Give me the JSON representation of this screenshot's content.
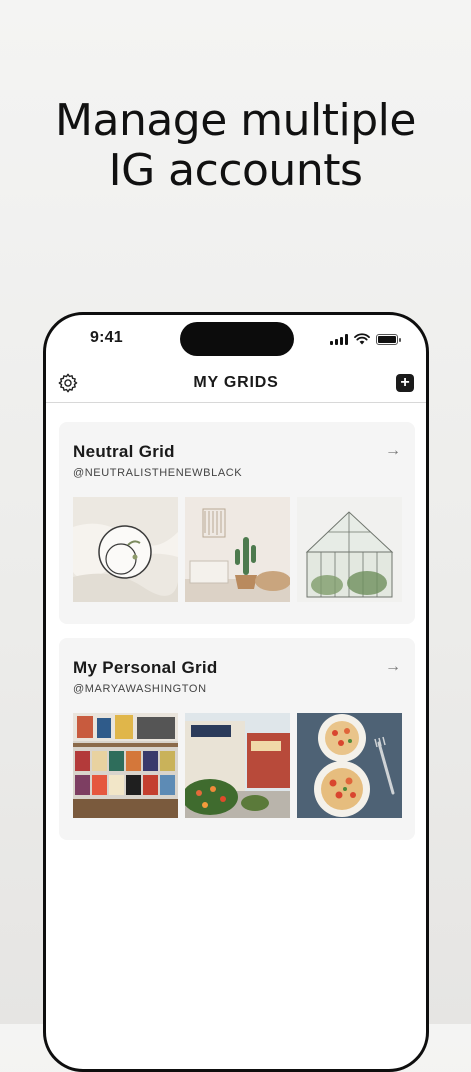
{
  "headline": {
    "line1": "Manage multiple",
    "line2": "IG accounts"
  },
  "status_bar": {
    "time": "9:41"
  },
  "navbar": {
    "title": "MY GRIDS",
    "add_label": "+"
  },
  "grids": [
    {
      "title": "Neutral Grid",
      "handle": "@NEUTRALISTHENEWBLACK",
      "arrow": "→",
      "images": [
        "white-plate-on-linen",
        "cactus-room-interior",
        "glass-greenhouse"
      ]
    },
    {
      "title": "My Personal Grid",
      "handle": "@MARYAWASHINGTON",
      "arrow": "→",
      "images": [
        "record-store-shelves",
        "street-cafe-flowers",
        "shrimp-pasta-bowls"
      ]
    }
  ],
  "colors": {
    "card_bg": "#f5f5f5",
    "phone_frame": "#0e0e0e",
    "text": "#1a1a1a"
  }
}
